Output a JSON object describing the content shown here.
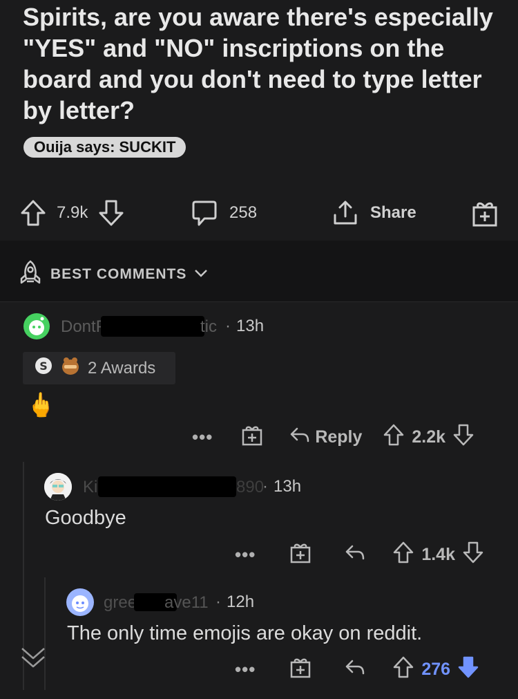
{
  "post": {
    "title": "Spirits, are you aware there's especially \"YES\" and \"NO\" inscriptions on the board and you don't need to type letter by letter?",
    "flair": "Ouija says: SUCKIT"
  },
  "post_actions": {
    "score": "7.9k",
    "comments": "258",
    "share_label": "Share"
  },
  "sort": {
    "label": "BEST COMMENTS"
  },
  "comments": [
    {
      "author_visible": "DontP",
      "author_suffix_visible": "tic",
      "time": "13h",
      "awards_label": "2 Awards",
      "body": "🖕",
      "reply_label": "Reply",
      "score": "2.2k"
    },
    {
      "author_visible": "Ki",
      "author_suffix_visible": "890",
      "time": "13h",
      "body": "Goodbye",
      "score": "1.4k"
    },
    {
      "author_visible": "gree",
      "author_suffix_visible": "ave11",
      "time": "12h",
      "body": "The only time emojis are okay on reddit.",
      "score": "276"
    }
  ],
  "colors": {
    "background": "#1b1b1c",
    "downvote_active": "#7193ff",
    "text": "#d7dadc"
  }
}
